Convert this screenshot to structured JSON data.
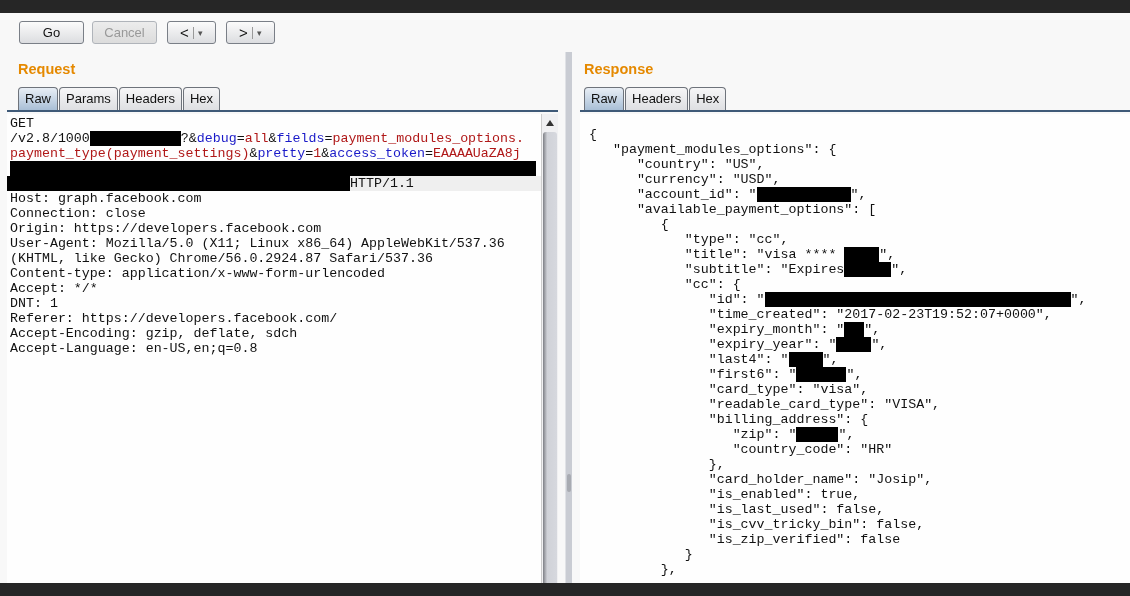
{
  "toolbar": {
    "buttons": [
      {
        "kind": "text",
        "label": "Go",
        "disabled": false
      },
      {
        "kind": "text",
        "label": "Cancel",
        "disabled": true
      },
      {
        "kind": "nav",
        "label": "<",
        "menu": "▾",
        "disabled": false
      },
      {
        "kind": "nav",
        "label": ">",
        "menu": "▾",
        "disabled": false
      }
    ]
  },
  "request": {
    "title": "Request",
    "tabs": [
      {
        "label": "Raw",
        "selected": true
      },
      {
        "label": "Params",
        "selected": false
      },
      {
        "label": "Headers",
        "selected": false
      },
      {
        "label": "Hex",
        "selected": false
      }
    ],
    "lines": [
      {
        "current": false,
        "segments": [
          {
            "kind": "plain",
            "text": "GET"
          }
        ]
      },
      {
        "current": false,
        "segments": [
          {
            "kind": "plain",
            "text": "/v2.8/1000"
          },
          {
            "kind": "redacted"
          },
          {
            "kind": "plain",
            "text": "?&"
          },
          {
            "kind": "param",
            "text": "debug"
          },
          {
            "kind": "plain",
            "text": "="
          },
          {
            "kind": "value",
            "text": "all"
          },
          {
            "kind": "plain",
            "text": "&"
          },
          {
            "kind": "param",
            "text": "fields"
          },
          {
            "kind": "plain",
            "text": "="
          },
          {
            "kind": "value",
            "text": "payment_modules_options."
          }
        ]
      },
      {
        "current": false,
        "segments": [
          {
            "kind": "value",
            "text": "payment_type(payment_settings)"
          },
          {
            "kind": "plain",
            "text": "&"
          },
          {
            "kind": "param",
            "text": "pretty"
          },
          {
            "kind": "plain",
            "text": "="
          },
          {
            "kind": "value",
            "text": "1"
          },
          {
            "kind": "plain",
            "text": "&"
          },
          {
            "kind": "param",
            "text": "access_token"
          },
          {
            "kind": "plain",
            "text": "="
          },
          {
            "kind": "value",
            "text": "EAAAAUaZA8j"
          }
        ]
      },
      {
        "current": false,
        "segments": [
          {
            "kind": "redacted"
          }
        ]
      },
      {
        "current": true,
        "segments": [
          {
            "kind": "redacted"
          },
          {
            "kind": "plain",
            "text": "HTTP/1.1"
          }
        ]
      },
      {
        "current": false,
        "segments": [
          {
            "kind": "plain",
            "text": "Host: graph.facebook.com"
          }
        ]
      },
      {
        "current": false,
        "segments": [
          {
            "kind": "plain",
            "text": "Connection: close"
          }
        ]
      },
      {
        "current": false,
        "segments": [
          {
            "kind": "plain",
            "text": "Origin: https://developers.facebook.com"
          }
        ]
      },
      {
        "current": false,
        "segments": [
          {
            "kind": "plain",
            "text": "User-Agent: Mozilla/5.0 (X11; Linux x86_64) AppleWebKit/537.36"
          }
        ]
      },
      {
        "current": false,
        "segments": [
          {
            "kind": "plain",
            "text": "(KHTML, like Gecko) Chrome/56.0.2924.87 Safari/537.36"
          }
        ]
      },
      {
        "current": false,
        "segments": [
          {
            "kind": "plain",
            "text": "Content-type: application/x-www-form-urlencoded"
          }
        ]
      },
      {
        "current": false,
        "segments": [
          {
            "kind": "plain",
            "text": "Accept: */*"
          }
        ]
      },
      {
        "current": false,
        "segments": [
          {
            "kind": "plain",
            "text": "DNT: 1"
          }
        ]
      },
      {
        "current": false,
        "segments": [
          {
            "kind": "plain",
            "text": "Referer: https://developers.facebook.com/"
          }
        ]
      },
      {
        "current": false,
        "segments": [
          {
            "kind": "plain",
            "text": "Accept-Encoding: gzip, deflate, sdch"
          }
        ]
      },
      {
        "current": false,
        "segments": [
          {
            "kind": "plain",
            "text": "Accept-Language: en-US,en;q=0.8"
          }
        ]
      }
    ]
  },
  "response": {
    "title": "Response",
    "tabs": [
      {
        "label": "Raw",
        "selected": true
      },
      {
        "label": "Headers",
        "selected": false
      },
      {
        "label": "Hex",
        "selected": false
      }
    ],
    "lines": [
      {
        "segments": [
          {
            "kind": "plain",
            "text": "{"
          }
        ]
      },
      {
        "segments": [
          {
            "kind": "plain",
            "text": "   \"payment_modules_options\": {"
          }
        ]
      },
      {
        "segments": [
          {
            "kind": "plain",
            "text": "      \"country\": \"US\","
          }
        ]
      },
      {
        "segments": [
          {
            "kind": "plain",
            "text": "      \"currency\": \"USD\","
          }
        ]
      },
      {
        "segments": [
          {
            "kind": "plain",
            "text": "      \"account_id\": \""
          },
          {
            "kind": "redacted"
          },
          {
            "kind": "plain",
            "text": "\","
          }
        ]
      },
      {
        "segments": [
          {
            "kind": "plain",
            "text": "      \"available_payment_options\": ["
          }
        ]
      },
      {
        "segments": [
          {
            "kind": "plain",
            "text": "         {"
          }
        ]
      },
      {
        "segments": [
          {
            "kind": "plain",
            "text": "            \"type\": \"cc\","
          }
        ]
      },
      {
        "segments": [
          {
            "kind": "plain",
            "text": "            \"title\": \"visa **** "
          },
          {
            "kind": "redacted"
          },
          {
            "kind": "plain",
            "text": "\","
          }
        ]
      },
      {
        "segments": [
          {
            "kind": "plain",
            "text": "            \"subtitle\": \"Expires"
          },
          {
            "kind": "redacted"
          },
          {
            "kind": "plain",
            "text": "\","
          }
        ]
      },
      {
        "segments": [
          {
            "kind": "plain",
            "text": "            \"cc\": {"
          }
        ]
      },
      {
        "segments": [
          {
            "kind": "plain",
            "text": "               \"id\": \""
          },
          {
            "kind": "redacted"
          },
          {
            "kind": "plain",
            "text": "\","
          }
        ]
      },
      {
        "segments": [
          {
            "kind": "plain",
            "text": "               \"time_created\": \"2017-02-23T19:52:07+0000\","
          }
        ]
      },
      {
        "segments": [
          {
            "kind": "plain",
            "text": "               \"expiry_month\": \""
          },
          {
            "kind": "redacted"
          },
          {
            "kind": "plain",
            "text": "\","
          }
        ]
      },
      {
        "segments": [
          {
            "kind": "plain",
            "text": "               \"expiry_year\": \""
          },
          {
            "kind": "redacted"
          },
          {
            "kind": "plain",
            "text": "\","
          }
        ]
      },
      {
        "segments": [
          {
            "kind": "plain",
            "text": "               \"last4\": \""
          },
          {
            "kind": "redacted"
          },
          {
            "kind": "plain",
            "text": "\","
          }
        ]
      },
      {
        "segments": [
          {
            "kind": "plain",
            "text": "               \"first6\": \""
          },
          {
            "kind": "redacted"
          },
          {
            "kind": "plain",
            "text": "\","
          }
        ]
      },
      {
        "segments": [
          {
            "kind": "plain",
            "text": "               \"card_type\": \"visa\","
          }
        ]
      },
      {
        "segments": [
          {
            "kind": "plain",
            "text": "               \"readable_card_type\": \"VISA\","
          }
        ]
      },
      {
        "segments": [
          {
            "kind": "plain",
            "text": "               \"billing_address\": {"
          }
        ]
      },
      {
        "segments": [
          {
            "kind": "plain",
            "text": "                  \"zip\": \""
          },
          {
            "kind": "redacted"
          },
          {
            "kind": "plain",
            "text": "\","
          }
        ]
      },
      {
        "segments": [
          {
            "kind": "plain",
            "text": "                  \"country_code\": \"HR\""
          }
        ]
      },
      {
        "segments": [
          {
            "kind": "plain",
            "text": "               },"
          }
        ]
      },
      {
        "segments": [
          {
            "kind": "plain",
            "text": "               \"card_holder_name\": \"Josip\","
          }
        ]
      },
      {
        "segments": [
          {
            "kind": "plain",
            "text": "               \"is_enabled\": true,"
          }
        ]
      },
      {
        "segments": [
          {
            "kind": "plain",
            "text": "               \"is_last_used\": false,"
          }
        ]
      },
      {
        "segments": [
          {
            "kind": "plain",
            "text": "               \"is_cvv_tricky_bin\": false,"
          }
        ]
      },
      {
        "segments": [
          {
            "kind": "plain",
            "text": "               \"is_zip_verified\": false"
          }
        ]
      },
      {
        "segments": [
          {
            "kind": "plain",
            "text": "            }"
          }
        ]
      },
      {
        "segments": [
          {
            "kind": "plain",
            "text": "         },"
          }
        ]
      }
    ]
  }
}
